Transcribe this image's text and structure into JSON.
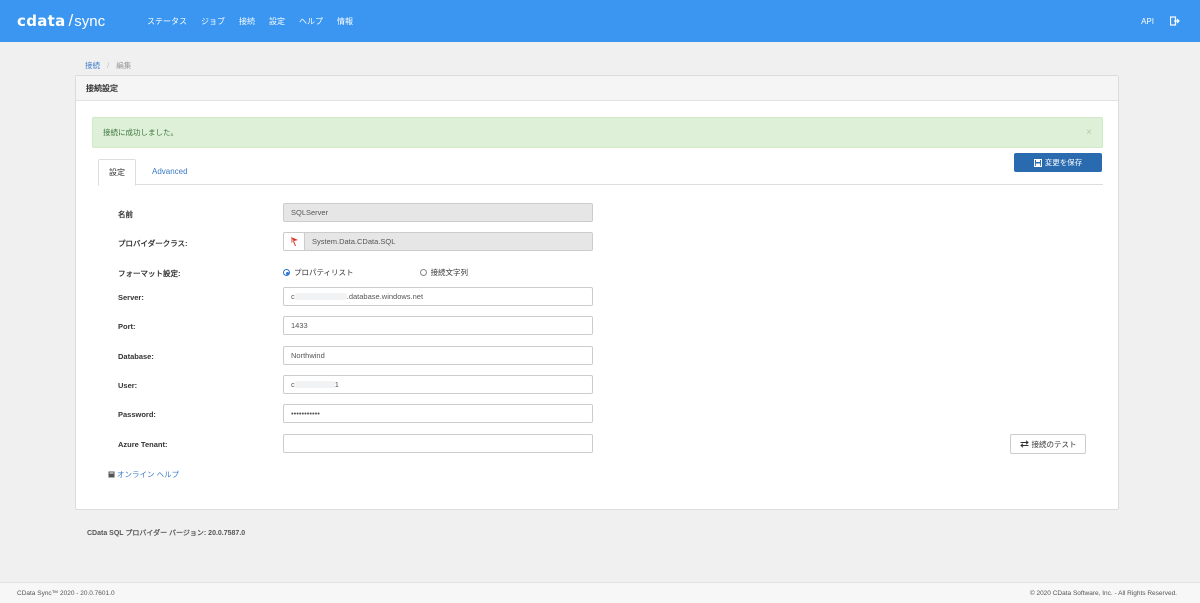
{
  "header": {
    "logo_brand": "cdata",
    "logo_slash": "/",
    "logo_product": "sync",
    "nav": [
      {
        "label": "ステータス"
      },
      {
        "label": "ジョブ"
      },
      {
        "label": "接続"
      },
      {
        "label": "設定"
      },
      {
        "label": "ヘルプ"
      },
      {
        "label": "情報"
      }
    ],
    "api_label": "API",
    "logout_icon": "logout-icon"
  },
  "breadcrumb": {
    "parent": "接続",
    "separator": "/",
    "current": "編集"
  },
  "panel": {
    "title": "接続設定",
    "alert": {
      "message": "接続に成功しました。",
      "close": "×"
    },
    "save_button": "変更を保存",
    "tabs": [
      {
        "label": "設定",
        "active": true
      },
      {
        "label": "Advanced",
        "active": false
      }
    ],
    "fields": {
      "name": {
        "label": "名前",
        "value": "SQLServer"
      },
      "provider_class": {
        "label": "プロバイダークラス:",
        "value": "System.Data.CData.SQL"
      },
      "format": {
        "label": "フォーマット設定:",
        "options": [
          {
            "label": "プロパティリスト",
            "checked": true
          },
          {
            "label": "接続文字列",
            "checked": false
          }
        ]
      },
      "server": {
        "label": "Server:",
        "value_prefix": "c",
        "value_suffix": ".database.windows.net"
      },
      "port": {
        "label": "Port:",
        "value": "1433"
      },
      "database": {
        "label": "Database:",
        "value": "Northwind"
      },
      "user": {
        "label": "User:",
        "value_prefix": "c",
        "value_suffix": "1"
      },
      "password": {
        "label": "Password:",
        "value": "•••••••••••"
      },
      "azure_tenant": {
        "label": "Azure Tenant:",
        "value": ""
      }
    },
    "test_button": "接続のテスト",
    "help_link": "オンライン ヘルプ"
  },
  "provider_version": "CData SQL プロバイダー バージョン: 20.0.7587.0",
  "footer": {
    "left": "CData Sync™ 2020 - 20.0.7601.0",
    "right": "© 2020 CData Software, Inc. - All Rights Reserved."
  },
  "colors": {
    "nav_bg": "#3a96f0",
    "primary_button": "#2a6bb0",
    "alert_bg": "#dff0d8",
    "alert_text": "#3c763d",
    "link": "#3a7bc8"
  }
}
